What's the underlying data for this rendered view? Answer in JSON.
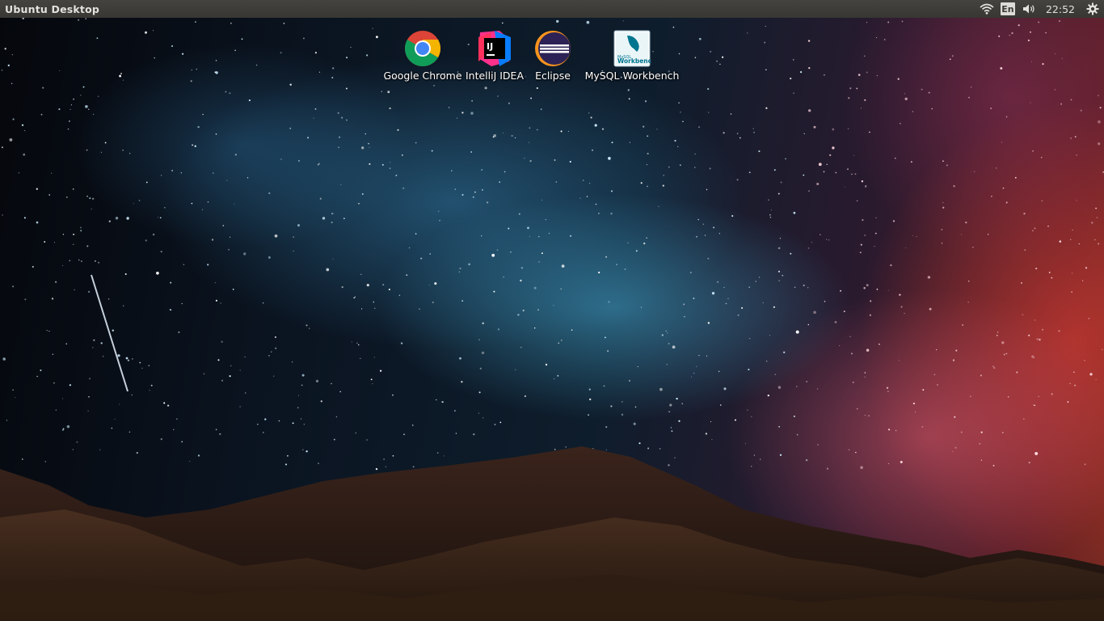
{
  "panel": {
    "title": "Ubuntu Desktop",
    "language": "En",
    "clock": "22:52",
    "icons": [
      "wifi-icon",
      "language-indicator",
      "volume-icon",
      "gear-icon"
    ]
  },
  "desktop": {
    "icons": [
      {
        "label": "Google Chrome",
        "icon": "chrome-icon"
      },
      {
        "label": "IntelliJ IDEA",
        "icon": "intellij-icon"
      },
      {
        "label": "Eclipse",
        "icon": "eclipse-icon"
      },
      {
        "label": "MySQL Workbench",
        "icon": "mysql-workbench-icon",
        "icon_text_small": "MySQL",
        "icon_text": "Workbench"
      }
    ]
  },
  "colors": {
    "panel_bg": "#3c3b37",
    "panel_text": "#e3e1dc",
    "chrome_red": "#db4437",
    "chrome_green": "#0f9d58",
    "chrome_yellow": "#f4b400",
    "chrome_blue": "#4285f4",
    "eclipse_orange": "#f7941e",
    "eclipse_purple": "#2c2255",
    "mysql_blue": "#00758f"
  }
}
